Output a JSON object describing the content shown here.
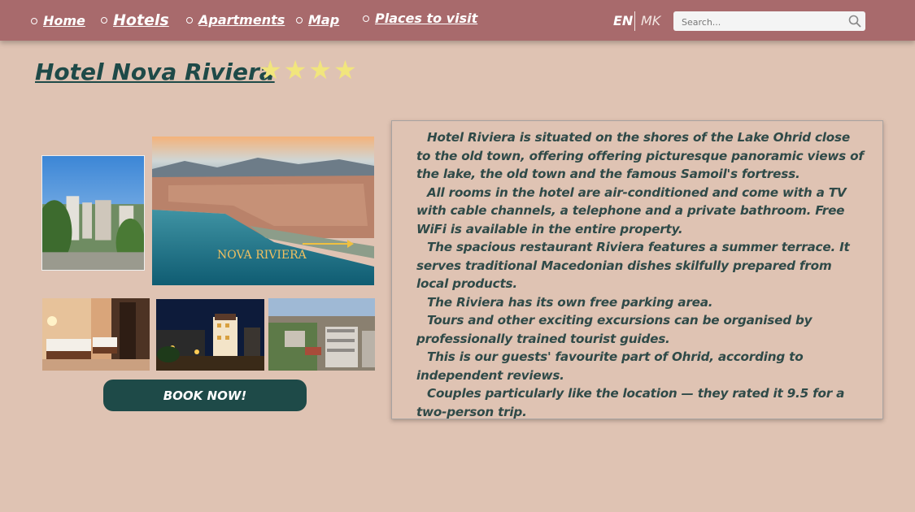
{
  "nav": {
    "items": [
      {
        "label": "Home"
      },
      {
        "label": "Hotels"
      },
      {
        "label": "Apartments"
      },
      {
        "label": "Map"
      },
      {
        "label": "Places to visit"
      }
    ],
    "lang_en": "EN",
    "lang_mk": "MK",
    "search_placeholder": "Search..."
  },
  "hotel": {
    "name": "Hotel Nova Riviera",
    "stars": 4,
    "book_label": "BOOK NOW!",
    "photo_logo": "NOVA RIVIERA",
    "description": [
      "Hotel Riviera is situated on the shores of the Lake Ohrid close to the old town, offering offering picturesque panoramic views of the lake, the old town and the famous Samoil's fortress.",
      "All rooms in the hotel are air-conditioned and come with a TV with cable channels, a telephone and a private bathroom. Free WiFi is available in the entire property.",
      "The spacious restaurant Riviera features a summer terrace. It serves traditional Macedonian dishes skilfully prepared from local products.",
      "The Riviera has its own free parking area.",
      "Tours and other exciting excursions can be organised by professionally trained tourist guides.",
      "This is our guests' favourite part of Ohrid, according to independent reviews.",
      "Couples particularly like the location — they rated it 9.5 for a two-person trip."
    ]
  },
  "colors": {
    "nav_bg": "#a86a6c",
    "page_bg": "#dfc3b3",
    "accent": "#1e4a48",
    "star": "#f1e57d"
  }
}
